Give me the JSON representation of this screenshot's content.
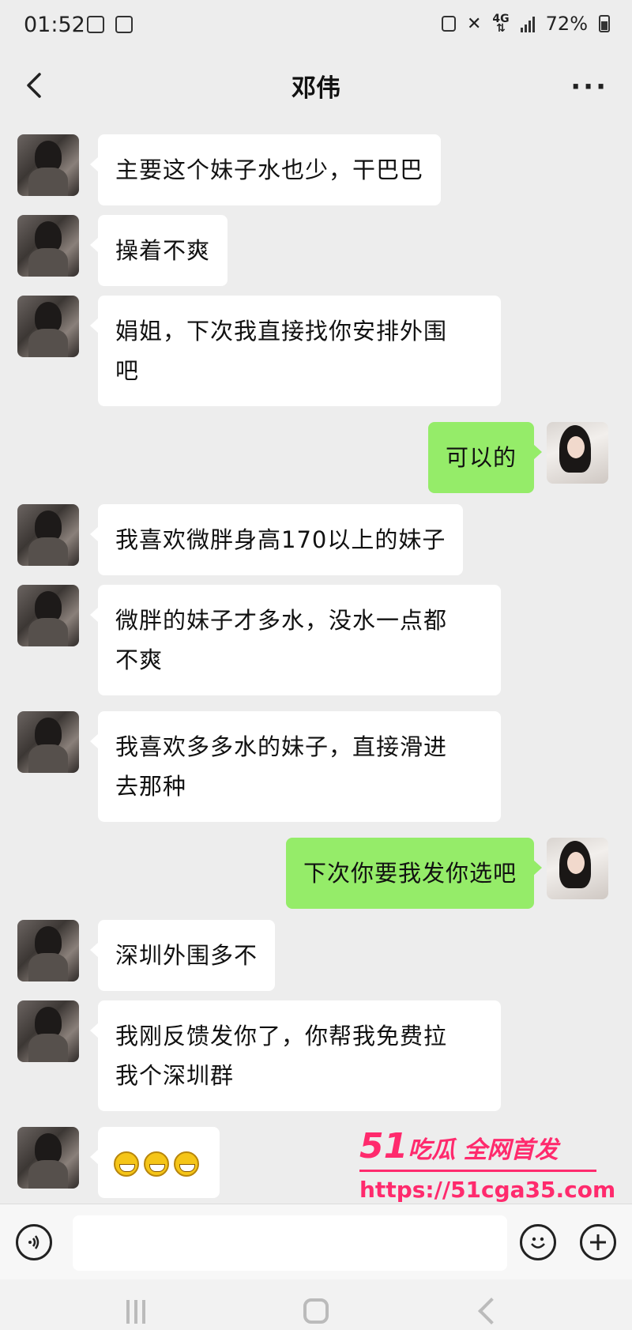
{
  "status_bar": {
    "time": "01:52",
    "network": "4G",
    "battery": "72%"
  },
  "header": {
    "title": "邓伟",
    "more": "···"
  },
  "messages": [
    {
      "side": "left",
      "text": "主要这个妹子水也少，干巴巴"
    },
    {
      "side": "left",
      "text": "操着不爽"
    },
    {
      "side": "left",
      "text": "娟姐，下次我直接找你安排外围\n吧"
    },
    {
      "side": "right",
      "text": "可以的"
    },
    {
      "side": "left",
      "text": "我喜欢微胖身高170以上的妹子"
    },
    {
      "side": "left",
      "text": "微胖的妹子才多水，没水一点都\n不爽"
    },
    {
      "side": "left",
      "text": "我喜欢多多水的妹子，直接滑进\n去那种"
    },
    {
      "side": "right",
      "text": "下次你要我发你选吧"
    },
    {
      "side": "left",
      "text": "深圳外围多不"
    },
    {
      "side": "left",
      "text": "我刚反馈发你了，你帮我免费拉\n我个深圳群"
    },
    {
      "side": "left",
      "emoji_count": 3,
      "emoji": "grin-emoji"
    }
  ],
  "watermark": {
    "number": "51",
    "text": "吃瓜 全网首发",
    "url": "https://51cga35.com"
  },
  "colors": {
    "background": "#ededed",
    "bubble_left": "#ffffff",
    "bubble_right": "#95ec69",
    "watermark": "#ff2a6d"
  }
}
